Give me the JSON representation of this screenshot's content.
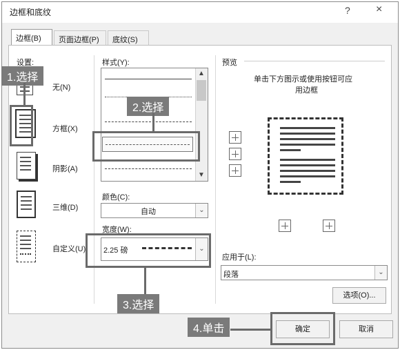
{
  "dialog": {
    "title": "边框和底纹",
    "help": "?",
    "close": "×"
  },
  "tabs": [
    {
      "label": "边框(B)",
      "active": true
    },
    {
      "label": "页面边框(P)",
      "active": false
    },
    {
      "label": "底纹(S)",
      "active": false
    }
  ],
  "settings": {
    "label": "设置:",
    "items": [
      {
        "label": "无(N)"
      },
      {
        "label": "方框(X)"
      },
      {
        "label": "阴影(A)"
      },
      {
        "label": "三维(D)"
      },
      {
        "label": "自定义(U)"
      }
    ]
  },
  "style": {
    "label": "样式(Y):"
  },
  "color": {
    "label": "颜色(C):",
    "value": "自动"
  },
  "width": {
    "label": "宽度(W):",
    "value": "2.25 磅"
  },
  "preview": {
    "label": "预览",
    "hint_line1": "单击下方图示或使用按钮可应",
    "hint_line2": "用边框"
  },
  "apply_to": {
    "label": "应用于(L):",
    "value": "段落"
  },
  "buttons": {
    "options": "选项(O)...",
    "ok": "确定",
    "cancel": "取消"
  },
  "annotations": {
    "step1": "1.选择",
    "step2": "2.选择",
    "step3": "3.选择",
    "step4": "4.单击"
  },
  "colors": {
    "callout": "#6a6a6a",
    "stamp": "#7a7a7a"
  }
}
